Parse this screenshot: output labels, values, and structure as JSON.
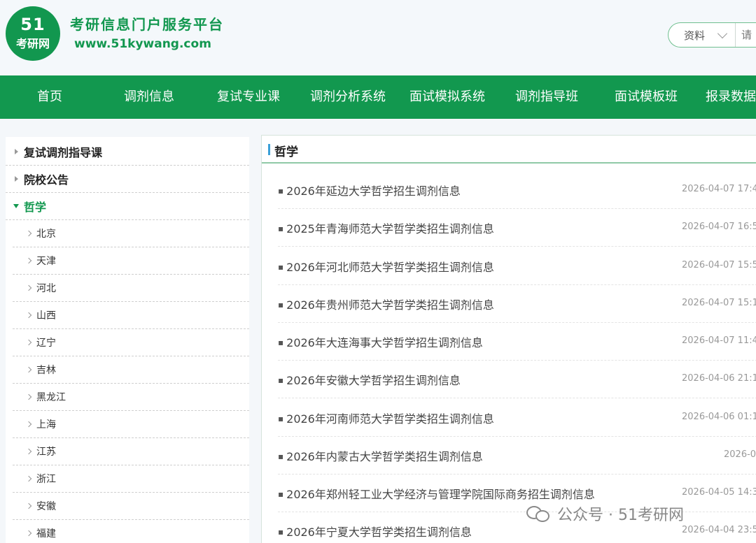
{
  "header": {
    "logo_number": "51",
    "logo_name": "考研网",
    "slogan": "考研信息门户服务平台",
    "url": "www.51kywang.com",
    "search": {
      "category": "资料",
      "placeholder": "请"
    }
  },
  "nav": {
    "items": [
      "首页",
      "调剂信息",
      "复试专业课",
      "调剂分析系统",
      "面试模拟系统",
      "调剂指导班",
      "面试模板班",
      "报录数据"
    ]
  },
  "sidebar": {
    "categories": [
      "复试调剂指导课",
      "院校公告",
      "哲学"
    ],
    "regions": [
      "北京",
      "天津",
      "河北",
      "山西",
      "辽宁",
      "吉林",
      "黑龙江",
      "上海",
      "江苏",
      "浙江",
      "安徽",
      "福建"
    ]
  },
  "panel": {
    "title": "哲学",
    "articles": [
      {
        "title": "2026年延边大学哲学招生调剂信息",
        "date": "2026-04-07 17:4"
      },
      {
        "title": "2025年青海师范大学哲学类招生调剂信息",
        "date": "2026-04-07 16:5"
      },
      {
        "title": "2026年河北师范大学哲学类招生调剂信息",
        "date": "2026-04-07 15:5"
      },
      {
        "title": "2026年贵州师范大学哲学类招生调剂信息",
        "date": "2026-04-07 15:1"
      },
      {
        "title": "2026年大连海事大学哲学招生调剂信息",
        "date": "2026-04-07 11:4"
      },
      {
        "title": "2026年安徽大学哲学招生调剂信息",
        "date": "2026-04-06 21:1"
      },
      {
        "title": "2026年河南师范大学哲学类招生调剂信息",
        "date": "2026-04-06 01:1"
      },
      {
        "title": "2026年内蒙古大学哲学类招生调剂信息",
        "date": "2026-0"
      },
      {
        "title": "2026年郑州轻工业大学经济与管理学院国际商务招生调剂信息",
        "date": "2026-04-05 14:3"
      },
      {
        "title": "2026年宁夏大学哲学类招生调剂信息",
        "date": "2026-04-04 23:5"
      }
    ]
  },
  "watermark": {
    "text": "公众号 · 51考研网"
  }
}
